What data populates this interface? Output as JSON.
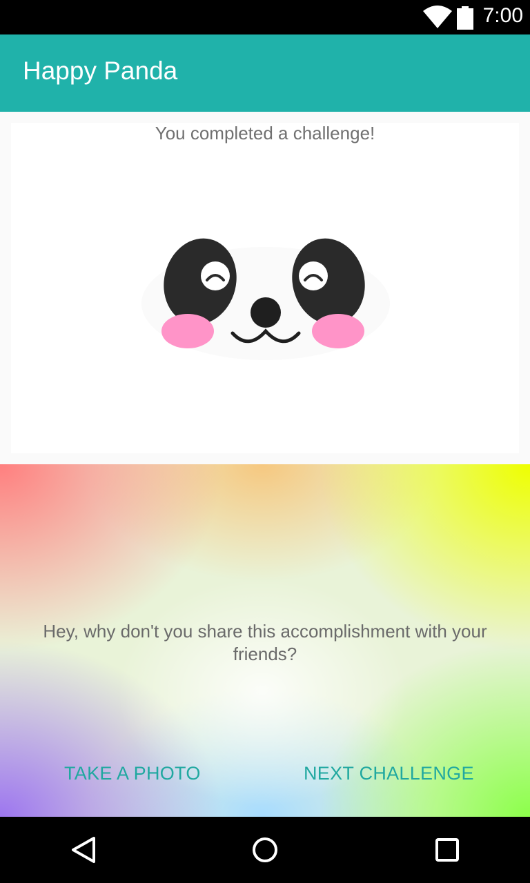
{
  "status_bar": {
    "time": "7:00",
    "icons": [
      "wifi-icon",
      "battery-icon"
    ]
  },
  "app_bar": {
    "title": "Happy Panda",
    "color": "#20b2aa"
  },
  "card": {
    "message": "You completed a challenge!",
    "image": "panda-face"
  },
  "share": {
    "text": "Hey, why don't you share this accomplishment with your friends?",
    "take_photo_label": "TAKE A PHOTO",
    "next_challenge_label": "NEXT CHALLENGE",
    "button_color": "#20a8a0"
  },
  "nav_bar": {
    "icons": [
      "back-icon",
      "home-icon",
      "recents-icon"
    ]
  }
}
